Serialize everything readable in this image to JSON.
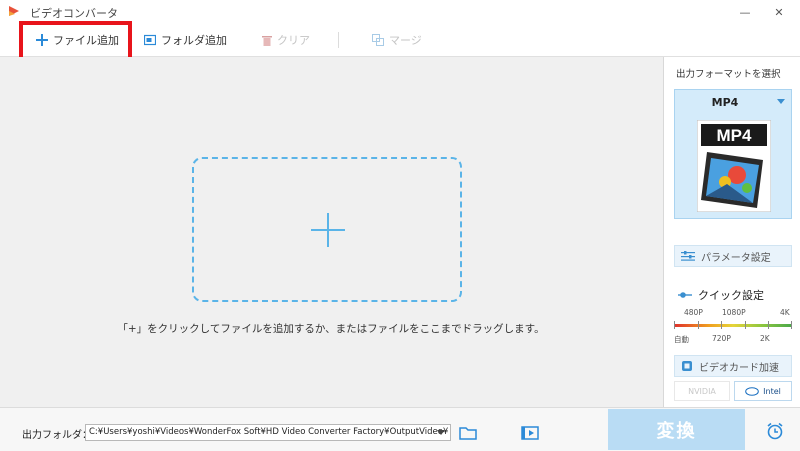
{
  "window": {
    "title": "ビデオコンバータ",
    "minimize": "—",
    "close": "✕"
  },
  "toolbar": {
    "add_file": "ファイル追加",
    "add_folder": "フォルダ追加",
    "clear": "クリア",
    "merge": "マージ"
  },
  "main": {
    "hint": "「+」をクリックしてファイルを追加するか、またはファイルをここまでドラッグします。"
  },
  "right_panel": {
    "output_format_label": "出力フォーマットを選択",
    "format_name": "MP4",
    "format_icon_text": "MP4",
    "parameter_settings": "パラメータ設定",
    "quick_settings": "クイック設定",
    "quality_top": [
      "480P",
      "1080P",
      "4K"
    ],
    "quality_bottom": [
      "自動",
      "720P",
      "2K"
    ],
    "gpu_accel": "ビデオカード加速",
    "nvidia": "NVIDIA",
    "intel": "Intel"
  },
  "bottom": {
    "output_folder_label": "出力フォルダ：",
    "output_path": "C:¥Users¥yoshi¥Videos¥WonderFox Soft¥HD Video Converter Factory¥OutputVideo¥",
    "convert": "変換"
  },
  "colors": {
    "accent": "#5ab4e8",
    "highlight": "#e8141b",
    "convert_bg": "#b9dcf4"
  }
}
